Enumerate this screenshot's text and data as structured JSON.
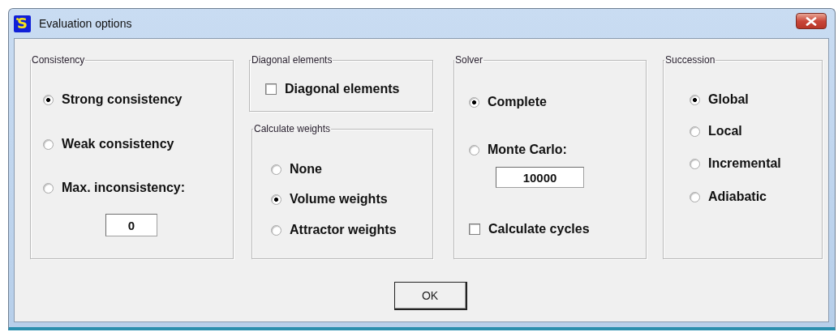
{
  "window": {
    "title": "Evaluation options",
    "icon_text": "S"
  },
  "columns": [
    [
      {
        "title": "Consistency",
        "items": [
          {
            "kind": "radio",
            "label": "Strong consistency",
            "selected": true
          },
          {
            "kind": "radio",
            "label": "Weak consistency",
            "selected": false
          },
          {
            "kind": "radio",
            "label": "Max. inconsistency:",
            "selected": false
          },
          {
            "kind": "field",
            "value": "0"
          }
        ]
      }
    ],
    [
      {
        "title": "Diagonal elements",
        "items": [
          {
            "kind": "checkbox",
            "label": "Diagonal elements",
            "checked": false
          }
        ]
      },
      {
        "title": "Calculate weights",
        "items": [
          {
            "kind": "radio",
            "label": "None",
            "selected": false
          },
          {
            "kind": "radio",
            "label": "Volume weights",
            "selected": true
          },
          {
            "kind": "radio",
            "label": "Attractor weights",
            "selected": false
          }
        ]
      }
    ],
    [
      {
        "title": "Solver",
        "items": [
          {
            "kind": "radio",
            "label": "Complete",
            "selected": true
          },
          {
            "kind": "radio",
            "label": "Monte Carlo:",
            "selected": false
          },
          {
            "kind": "field",
            "value": "10000"
          },
          {
            "kind": "checkbox",
            "label": "Calculate cycles",
            "checked": false
          }
        ]
      }
    ],
    [
      {
        "title": "Succession",
        "items": [
          {
            "kind": "radio",
            "label": "Global",
            "selected": true
          },
          {
            "kind": "radio",
            "label": "Local",
            "selected": false
          },
          {
            "kind": "radio",
            "label": "Incremental",
            "selected": false
          },
          {
            "kind": "radio",
            "label": "Adiabatic",
            "selected": false
          }
        ]
      }
    ]
  ],
  "ok_button": {
    "label": "OK"
  }
}
